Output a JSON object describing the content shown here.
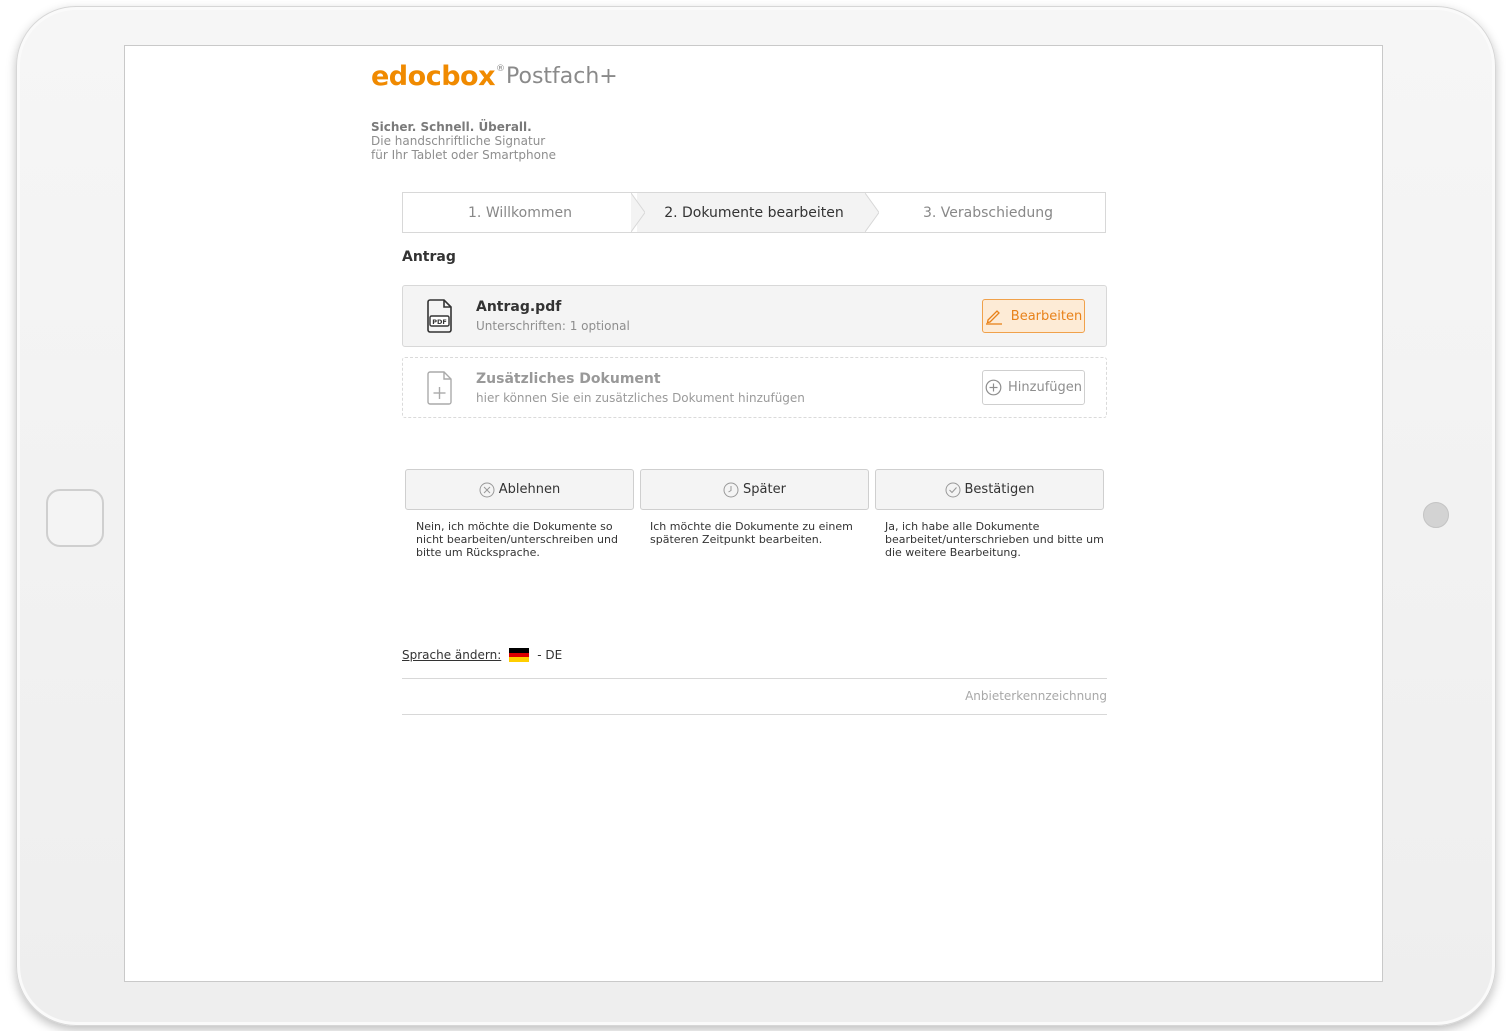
{
  "brand": {
    "name": "edocbox",
    "registered": "®",
    "product": "Postfach+",
    "color": "#f08a00"
  },
  "tagline": {
    "headline": "Sicher. Schnell. Überall.",
    "line1": "Die handschriftliche Signatur",
    "line2": "für Ihr Tablet oder Smartphone"
  },
  "steps": [
    {
      "label": "1. Willkommen",
      "active": false
    },
    {
      "label": "2. Dokumente bearbeiten",
      "active": true
    },
    {
      "label": "3. Verabschiedung",
      "active": false
    }
  ],
  "section": {
    "title": "Antrag"
  },
  "document": {
    "title": "Antrag.pdf",
    "subtitle": "Unterschriften: 1 optional",
    "icon": "pdf-file-icon",
    "icon_label": "PDF",
    "edit_label": "Bearbeiten"
  },
  "additional": {
    "title": "Zusätzliches Dokument",
    "subtitle": "hier können Sie ein zusätzliches Dokument hinzufügen",
    "icon": "add-file-icon",
    "add_label": "Hinzufügen"
  },
  "actions": [
    {
      "label": "Ablehnen",
      "icon": "x-circle-icon",
      "description": "Nein, ich möchte die Dokumente so nicht bearbeiten/unterschreiben und bitte um Rücksprache."
    },
    {
      "label": "Später",
      "icon": "clock-icon",
      "description": "Ich möchte die Dokumente zu einem späteren Zeitpunkt bearbeiten."
    },
    {
      "label": "Bestätigen",
      "icon": "check-circle-icon",
      "description": "Ja, ich habe alle Dokumente bearbeitet/unterschrieben und bitte um die weitere Bearbeitung."
    }
  ],
  "language": {
    "link_label": "Sprache ändern:",
    "current": "- DE",
    "flag_colors": [
      "#000000",
      "#dd0000",
      "#ffce00"
    ]
  },
  "footer": {
    "imprint_label": "Anbieterkennzeichnung"
  }
}
